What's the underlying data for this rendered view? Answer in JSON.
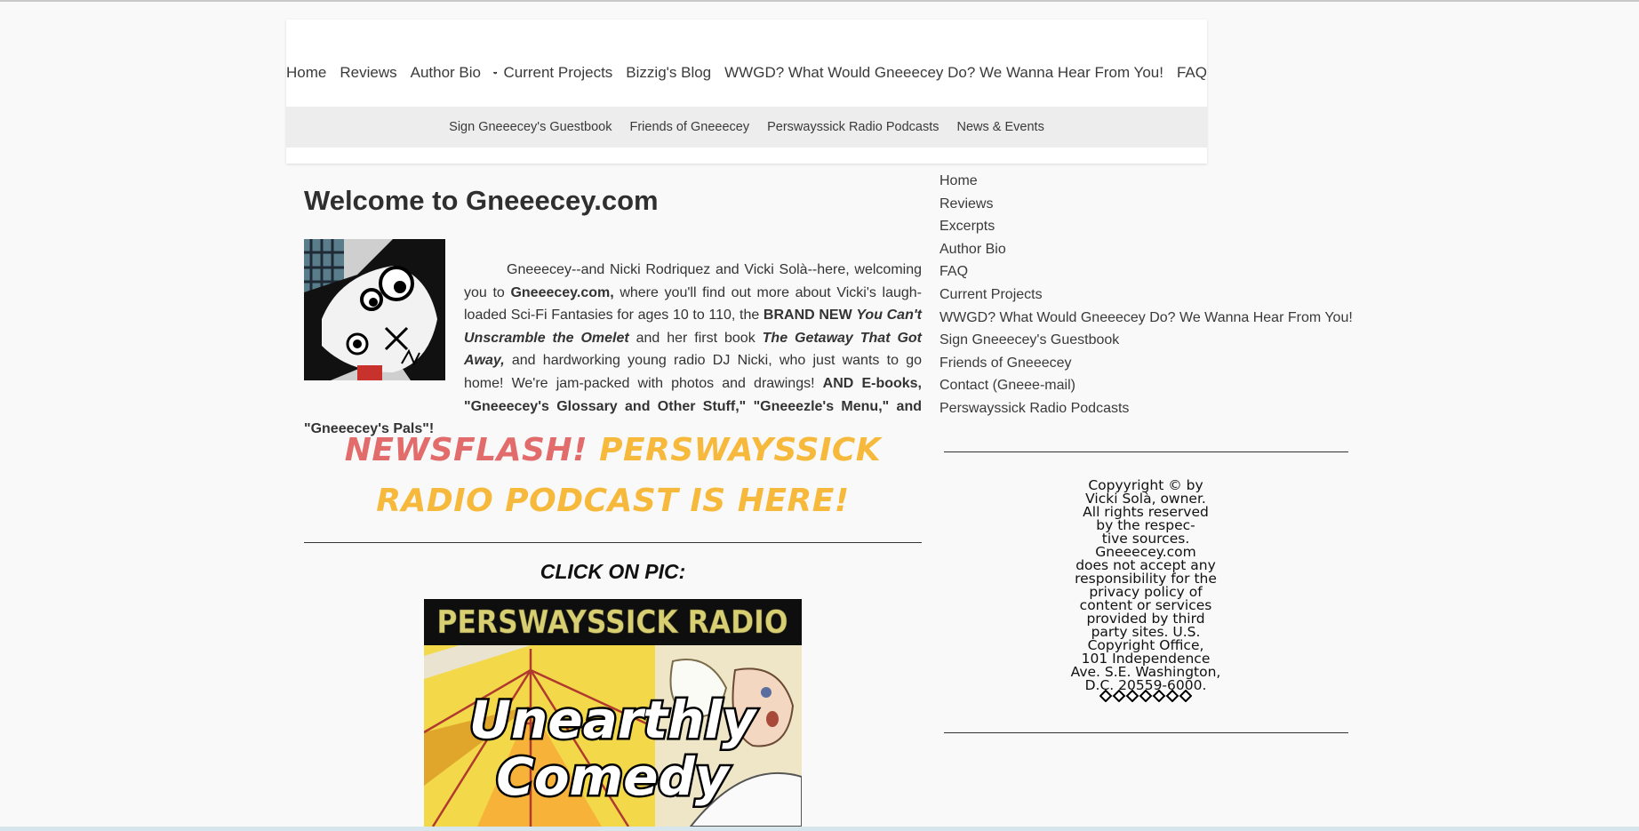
{
  "nav": {
    "main": [
      "Home",
      "Reviews",
      "Author Bio",
      "Current Projects",
      "Bizzig's Blog",
      "WWGD? What Would Gneeecey Do? We Wanna Hear From You!",
      "FAQ"
    ],
    "sub": [
      "Sign Gneeecey's Guestbook",
      "Friends of Gneeecey",
      "Perswayssick Radio Podcasts",
      "News & Events"
    ]
  },
  "content": {
    "title": "Welcome to Gneeecey.com",
    "intro": {
      "t1": "Gneeecey--and Nicki Rodriquez and Vicki Solà--here, welcoming you to ",
      "site": "Gneeecey.com,",
      "t2": " where you'll find out more about Vicki's laugh-loaded Sci-Fi Fantasies for ages 10 to 110, the ",
      "brand_new": "BRAND NEW ",
      "book1": "You Can't Unscramble the Omelet",
      "t3": " and her first book ",
      "book2": "The Getaway That Got Away,",
      "t4": " and hardworking young radio DJ Nicki, who just wants to go home! We're jam-packed with photos and drawings! ",
      "ebooks": "AND E-books, \"Gneeecey's Glossary and Other Stuff,\" \"Gneeezle's Menu,\" and \"Gneeecey's Pals\"!"
    },
    "newsflash_red": "NEWSFLASH!",
    "newsflash_orange": "PERSWAYSSICK RADIO PODCAST IS HERE!",
    "click_on_pic": "CLICK ON PIC:",
    "banner": {
      "top_text": "PERSWAYSSICK RADIO",
      "line1": "Unearthly",
      "line2": "Comedy"
    }
  },
  "sidebar": {
    "links": [
      "Home",
      "Reviews",
      "Excerpts",
      "Author Bio",
      "FAQ",
      "Current Projects",
      "WWGD? What Would Gneeecey Do? We Wanna Hear From You!",
      "Sign Gneeecey's Guestbook",
      "Friends of Gneeecey",
      "Contact (Gneee-mail)",
      "Perswayssick Radio Podcasts"
    ],
    "copyright_lines": [
      "Copyyright © by",
      "Vicki Solà, owner.",
      "All rights reserved",
      "by the respec-",
      "tive sources.",
      "Gneeecey.com",
      "does not accept any",
      "responsibility for the",
      "privacy policy of",
      "content or services",
      "provided by third",
      "party sites. U.S.",
      "Copyright Office,",
      "101 Independence",
      "Ave. S.E. Washington,",
      "D.C. 20559-6000."
    ]
  },
  "colors": {
    "newsflash_red": "#e26b6b",
    "newsflash_orange": "#f6b93b",
    "banner_title": "#d8cf72"
  }
}
